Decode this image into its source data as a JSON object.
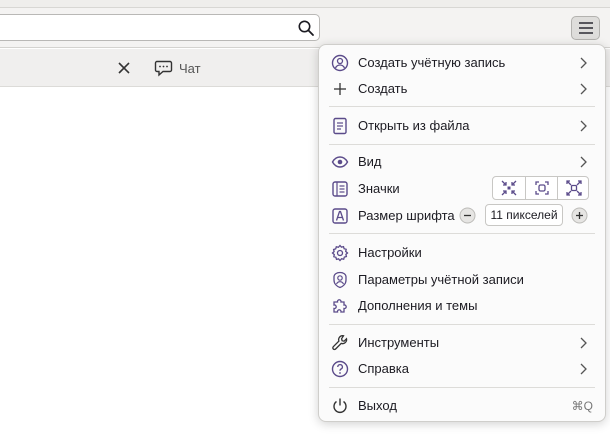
{
  "toolbar": {
    "search": {
      "value": "",
      "icon": "search-icon"
    },
    "menu_button": {
      "icon": "hamburger-icon"
    }
  },
  "tabbar": {
    "close_icon": "close-icon",
    "chat_icon": "chat-icon",
    "chat_label": "Чат"
  },
  "menu": {
    "create_account": "Создать учётную запись",
    "create": "Создать",
    "open_file": "Открыть из файла",
    "view": "Вид",
    "icons": "Значки",
    "font_size": "Размер шрифта",
    "font_size_value": "11 пикселей",
    "settings": "Настройки",
    "account_settings": "Параметры учётной записи",
    "addons": "Дополнения и темы",
    "tools": "Инструменты",
    "help": "Справка",
    "exit": "Выход",
    "exit_shortcut": "⌘Q"
  },
  "colors": {
    "accent": "#5b4b8a",
    "panel_bg": "#fbfbfb"
  }
}
